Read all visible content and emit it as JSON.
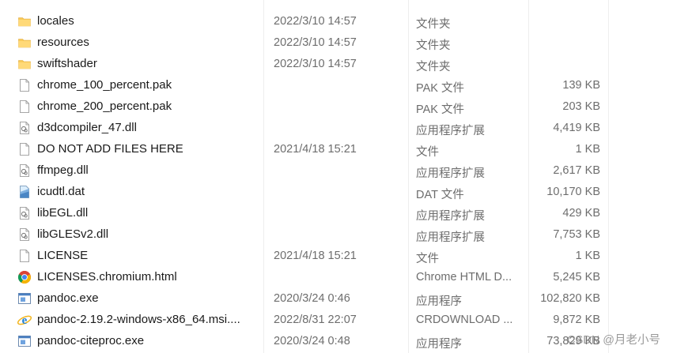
{
  "files": [
    {
      "name": "locales",
      "date": "2022/3/10 14:57",
      "type": "文件夹",
      "size": "",
      "icon": "folder-icon"
    },
    {
      "name": "resources",
      "date": "2022/3/10 14:57",
      "type": "文件夹",
      "size": "",
      "icon": "folder-icon"
    },
    {
      "name": "swiftshader",
      "date": "2022/3/10 14:57",
      "type": "文件夹",
      "size": "",
      "icon": "folder-icon"
    },
    {
      "name": "chrome_100_percent.pak",
      "date": "",
      "type": "PAK 文件",
      "size": "139 KB",
      "icon": "blank-file-icon"
    },
    {
      "name": "chrome_200_percent.pak",
      "date": "",
      "type": "PAK 文件",
      "size": "203 KB",
      "icon": "blank-file-icon"
    },
    {
      "name": "d3dcompiler_47.dll",
      "date": "",
      "type": "应用程序扩展",
      "size": "4,419 KB",
      "icon": "dll-file-icon"
    },
    {
      "name": "DO NOT ADD FILES HERE",
      "date": "2021/4/18 15:21",
      "type": "文件",
      "size": "1 KB",
      "icon": "blank-file-icon"
    },
    {
      "name": "ffmpeg.dll",
      "date": "",
      "type": "应用程序扩展",
      "size": "2,617 KB",
      "icon": "dll-file-icon"
    },
    {
      "name": "icudtl.dat",
      "date": "",
      "type": "DAT 文件",
      "size": "10,170 KB",
      "icon": "data-file-icon"
    },
    {
      "name": "libEGL.dll",
      "date": "",
      "type": "应用程序扩展",
      "size": "429 KB",
      "icon": "dll-file-icon"
    },
    {
      "name": "libGLESv2.dll",
      "date": "",
      "type": "应用程序扩展",
      "size": "7,753 KB",
      "icon": "dll-file-icon"
    },
    {
      "name": "LICENSE",
      "date": "2021/4/18 15:21",
      "type": "文件",
      "size": "1 KB",
      "icon": "blank-file-icon"
    },
    {
      "name": "LICENSES.chromium.html",
      "date": "",
      "type": "Chrome HTML D...",
      "size": "5,245 KB",
      "icon": "chrome-icon"
    },
    {
      "name": "pandoc.exe",
      "date": "2020/3/24 0:46",
      "type": "应用程序",
      "size": "102,820 KB",
      "icon": "exe-icon"
    },
    {
      "name": "pandoc-2.19.2-windows-x86_64.msi....",
      "date": "2022/8/31 22:07",
      "type": "CRDOWNLOAD ...",
      "size": "9,872 KB",
      "icon": "ie-icon"
    },
    {
      "name": "pandoc-citeproc.exe",
      "date": "2020/3/24 0:48",
      "type": "应用程序",
      "size": "73,829 KB",
      "icon": "exe-icon"
    }
  ],
  "watermark": "CSDN @月老小号",
  "colors": {
    "folder": "#f8c855",
    "text_primary": "#1a1a1a",
    "text_secondary": "#6d6d6d"
  }
}
